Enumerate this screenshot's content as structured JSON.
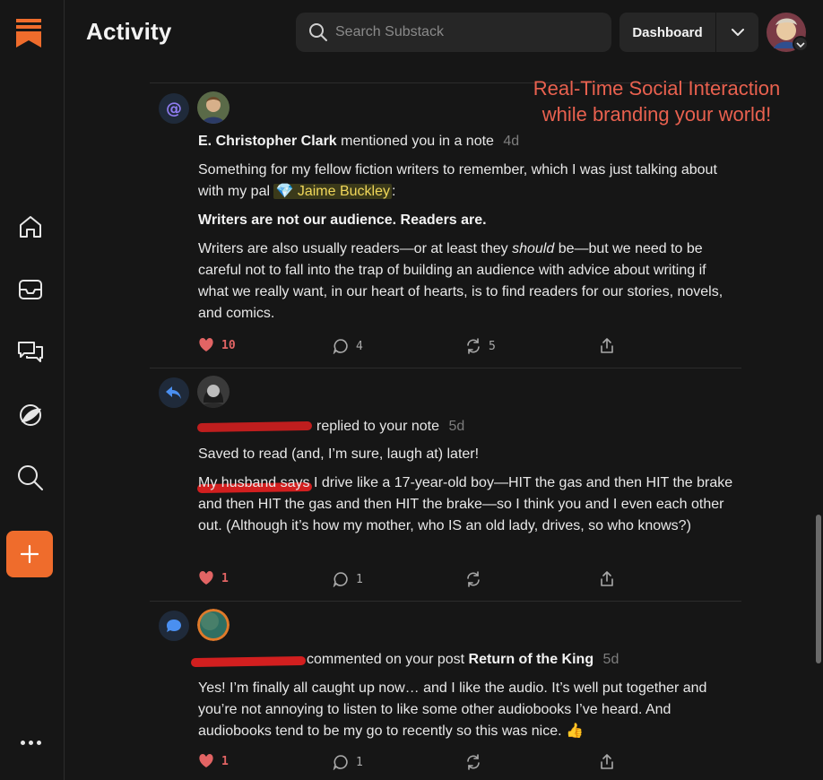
{
  "app": {
    "logo": "substack-logo",
    "accent": "#ef6c2c"
  },
  "sidebar": {
    "items": [
      {
        "name": "home-icon"
      },
      {
        "name": "inbox-icon"
      },
      {
        "name": "chat-icon"
      },
      {
        "name": "explore-icon"
      },
      {
        "name": "search-icon"
      }
    ],
    "add_label": "+",
    "more_label": "•••"
  },
  "header": {
    "title": "Activity",
    "search_placeholder": "Search Substack",
    "dashboard_label": "Dashboard"
  },
  "caption": {
    "line1": "Real-Time Social Interaction",
    "line2": "while branding your world!"
  },
  "feed": [
    {
      "type": "mention",
      "user": "E. Christopher Clark",
      "action": "mentioned you in a note",
      "ago": "4d",
      "p1_before": "Something for my fellow fiction writers to remember, which I was just talking about with my pal",
      "mention": "💎 Jaime Buckley",
      "p1_after": ":",
      "p2": "Writers are not our audience. Readers are.",
      "p3_a": "Writers are also usually readers—or at least they",
      "p3_em": "should",
      "p3_b": "be—but we need to be careful not to fall into the trap of building an audience with advice about writing if what we really want, in our heart of hearts, is to find readers for our stories, novels, and comics.",
      "likes": "10",
      "comments": "4",
      "restacks": "5"
    },
    {
      "type": "reply",
      "action": "replied to your note",
      "ago": "5d",
      "p1": "Saved to read (and, I’m sure, laugh at) later!",
      "p2": "My husband says I drive like a 17-year-old boy—HIT the gas and then HIT the brake and then HIT the gas and then HIT the brake—so I think you and I even each other out. (Although it’s how my mother, who IS an old lady, drives, so who knows?)",
      "likes": "1",
      "comments": "1"
    },
    {
      "type": "comment",
      "action": "commented on your post",
      "post": "Return of the King",
      "ago": "5d",
      "p1": "Yes! I’m finally all caught up now… and I like the audio. It’s well put together and you’re not annoying to listen to like some other audiobooks I’ve heard. And audiobooks tend to be my go to recently so this was nice. 👍",
      "likes": "1",
      "comments": "1"
    }
  ]
}
